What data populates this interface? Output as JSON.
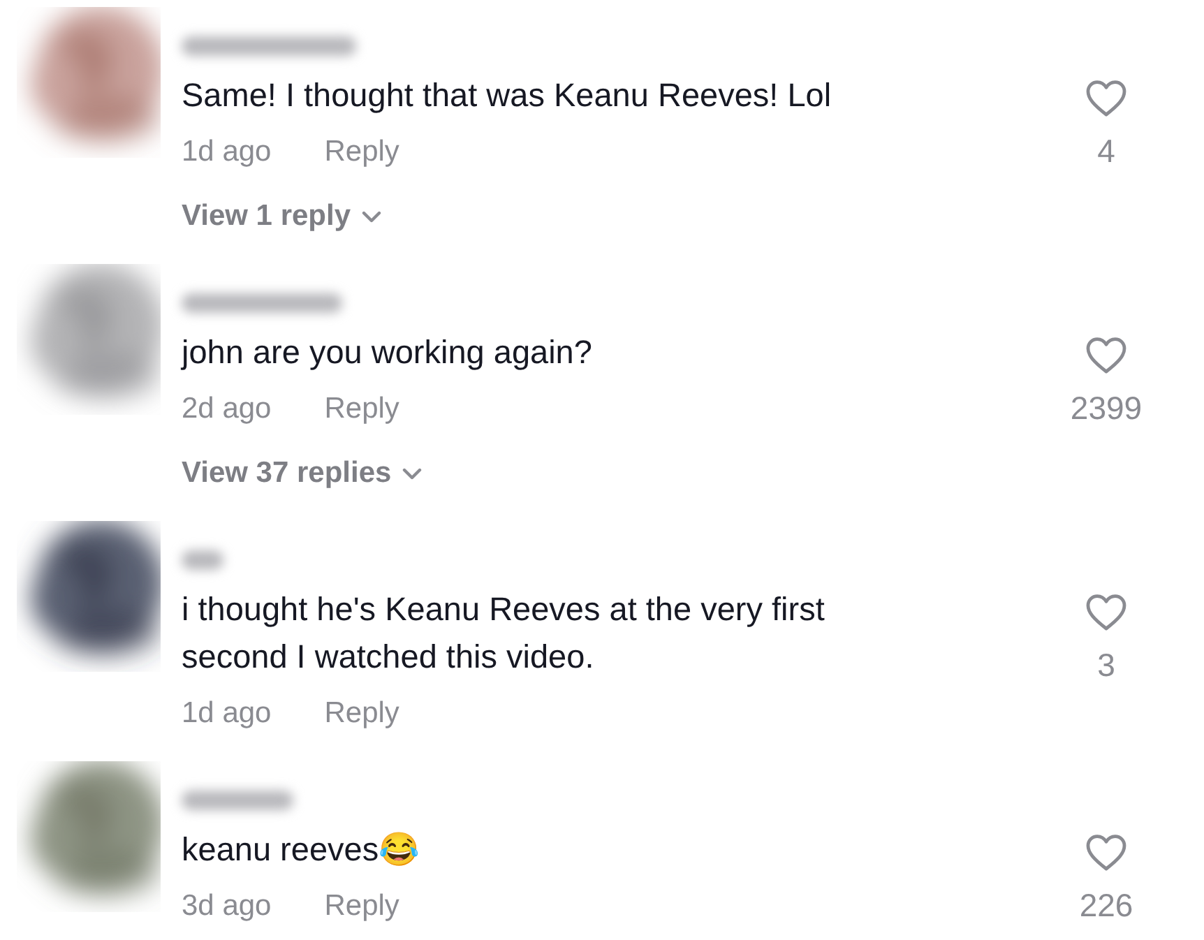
{
  "comments": [
    {
      "text": "Same! I thought that was Keanu Reeves! Lol",
      "time": "1d ago",
      "reply": "Reply",
      "liked": false,
      "likes": "4",
      "view_replies": "View 1 reply"
    },
    {
      "text": "john are you working again?",
      "time": "2d ago",
      "reply": "Reply",
      "liked": false,
      "likes": "2399",
      "view_replies": "View 37 replies"
    },
    {
      "text": "i thought he's Keanu Reeves at the very first second I watched this video.",
      "time": "1d ago",
      "reply": "Reply",
      "liked": false,
      "likes": "3"
    },
    {
      "text": "keanu reeves😂",
      "time": "3d ago",
      "reply": "Reply",
      "liked": false,
      "likes": "226"
    }
  ]
}
